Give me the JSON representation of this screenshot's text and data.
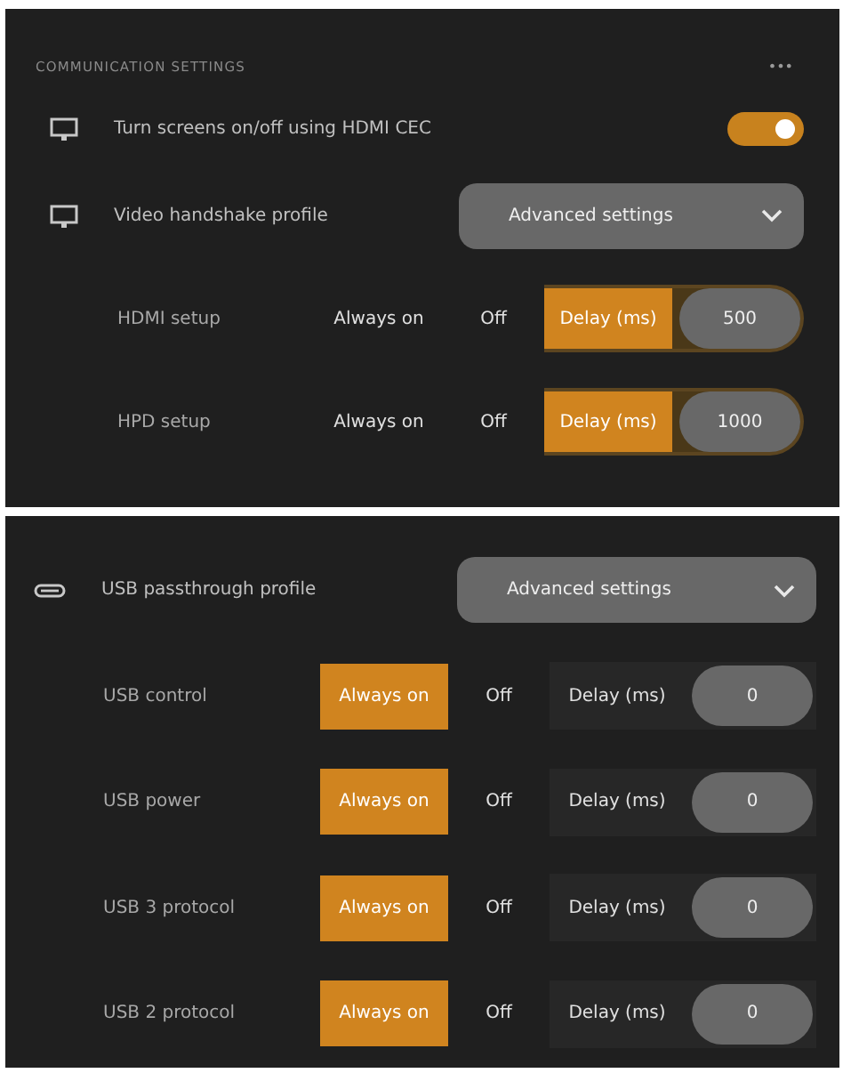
{
  "header": {
    "title": "COMMUNICATION SETTINGS",
    "menu": "•••"
  },
  "panels": [
    {
      "rows": [
        {
          "kind": "toggle",
          "label": "Turn screens on/off using HDMI CEC",
          "on": true
        },
        {
          "kind": "dropdown",
          "label": "Video handshake profile",
          "value": "Advanced settings"
        },
        {
          "kind": "mode",
          "label": "HDMI setup",
          "options": [
            {
              "label": "Always on",
              "selected": false
            },
            {
              "label": "Off",
              "selected": false
            },
            {
              "label": "Delay (ms)",
              "selected": true
            }
          ],
          "delay": "500"
        },
        {
          "kind": "mode",
          "label": "HPD setup",
          "options": [
            {
              "label": "Always on",
              "selected": false
            },
            {
              "label": "Off",
              "selected": false
            },
            {
              "label": "Delay (ms)",
              "selected": true
            }
          ],
          "delay": "1000"
        }
      ]
    },
    {
      "rows": [
        {
          "kind": "dropdown",
          "label": "USB passthrough profile",
          "value": "Advanced settings"
        },
        {
          "kind": "mode",
          "label": "USB control",
          "options": [
            {
              "label": "Always on",
              "selected": true
            },
            {
              "label": "Off",
              "selected": false
            },
            {
              "label": "Delay (ms)",
              "selected": false
            }
          ],
          "delay": "0"
        },
        {
          "kind": "mode",
          "label": "USB power",
          "options": [
            {
              "label": "Always on",
              "selected": true
            },
            {
              "label": "Off",
              "selected": false
            },
            {
              "label": "Delay (ms)",
              "selected": false
            }
          ],
          "delay": "0"
        },
        {
          "kind": "mode",
          "label": "USB 3 protocol",
          "options": [
            {
              "label": "Always on",
              "selected": true
            },
            {
              "label": "Off",
              "selected": false
            },
            {
              "label": "Delay (ms)",
              "selected": false
            }
          ],
          "delay": "0"
        },
        {
          "kind": "mode",
          "label": "USB 2 protocol",
          "options": [
            {
              "label": "Always on",
              "selected": true
            },
            {
              "label": "Off",
              "selected": false
            },
            {
              "label": "Delay (ms)",
              "selected": false
            }
          ],
          "delay": "0"
        }
      ]
    }
  ]
}
